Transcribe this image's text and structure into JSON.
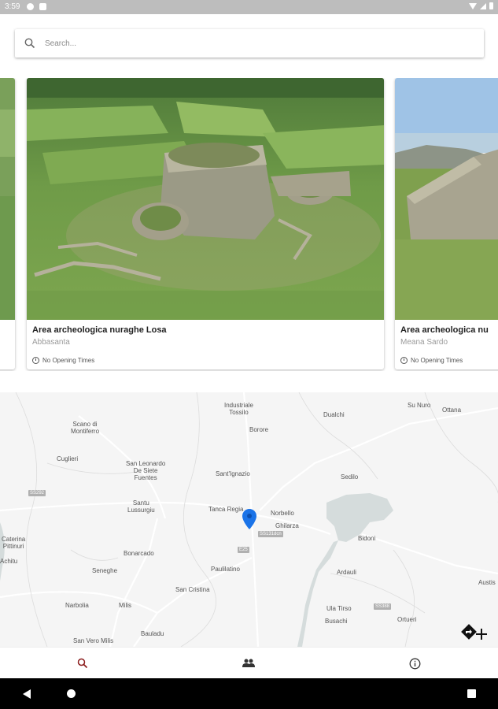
{
  "status_bar": {
    "time": "3:59"
  },
  "search": {
    "placeholder": "Search..."
  },
  "cards": [
    {
      "title": "",
      "subtitle": "",
      "hours": ""
    },
    {
      "title": "Area archeologica nuraghe Losa",
      "subtitle": "Abbasanta",
      "hours": "No Opening Times"
    },
    {
      "title": "Area archeologica nu",
      "subtitle": "Meana Sardo",
      "hours": "No Opening Times"
    }
  ],
  "map": {
    "places": [
      {
        "name": "Industriale\nTossilo",
        "key": "tossilo"
      },
      {
        "name": "Dualchi",
        "key": "dualchi"
      },
      {
        "name": "Su Nuro",
        "key": "sunuro"
      },
      {
        "name": "Ottana",
        "key": "ottana"
      },
      {
        "name": "Scano di\nMontiferro",
        "key": "scano"
      },
      {
        "name": "Borore",
        "key": "borore"
      },
      {
        "name": "Cuglieri",
        "key": "cuglieri"
      },
      {
        "name": "San Leonardo\nDe Siete\nFuentes",
        "key": "sanleonardo"
      },
      {
        "name": "Sant'Ignazio",
        "key": "santignazio"
      },
      {
        "name": "Sedilo",
        "key": "sedilo"
      },
      {
        "name": "Santu\nLussurgiu",
        "key": "santulussurgiu"
      },
      {
        "name": "Tanca Regia",
        "key": "tancaregia"
      },
      {
        "name": "Norbello",
        "key": "norbello"
      },
      {
        "name": "Ghilarza",
        "key": "ghilarza"
      },
      {
        "name": "Bidoni",
        "key": "bidoni"
      },
      {
        "name": "Caterina\nPittinuri",
        "key": "caterina"
      },
      {
        "name": "Bonarcado",
        "key": "bonarcado"
      },
      {
        "name": "Ardauli",
        "key": "ardauli"
      },
      {
        "name": "Paulilatino",
        "key": "paulilatino"
      },
      {
        "name": "Seneghe",
        "key": "seneghe"
      },
      {
        "name": "San Cristina",
        "key": "sancristina"
      },
      {
        "name": "Austis",
        "key": "austis"
      },
      {
        "name": "Narbolia",
        "key": "narbolia"
      },
      {
        "name": "Milis",
        "key": "milis"
      },
      {
        "name": "Ula Tirso",
        "key": "ulatirso"
      },
      {
        "name": "Busachi",
        "key": "busachi"
      },
      {
        "name": "Ortueri",
        "key": "ortueri"
      },
      {
        "name": "Bauladu",
        "key": "bauladu"
      },
      {
        "name": "San Vero Milis",
        "key": "sanveromilis"
      },
      {
        "name": "Achitu",
        "key": "achitu"
      }
    ],
    "road_badges": [
      "SS292",
      "SS131dcn",
      "E25",
      "SS388"
    ]
  },
  "bottom_nav": {
    "items": [
      {
        "icon": "search-icon",
        "active": true
      },
      {
        "icon": "people-icon",
        "active": false
      },
      {
        "icon": "info-icon",
        "active": false
      }
    ],
    "active_color": "#8b1c1c"
  }
}
